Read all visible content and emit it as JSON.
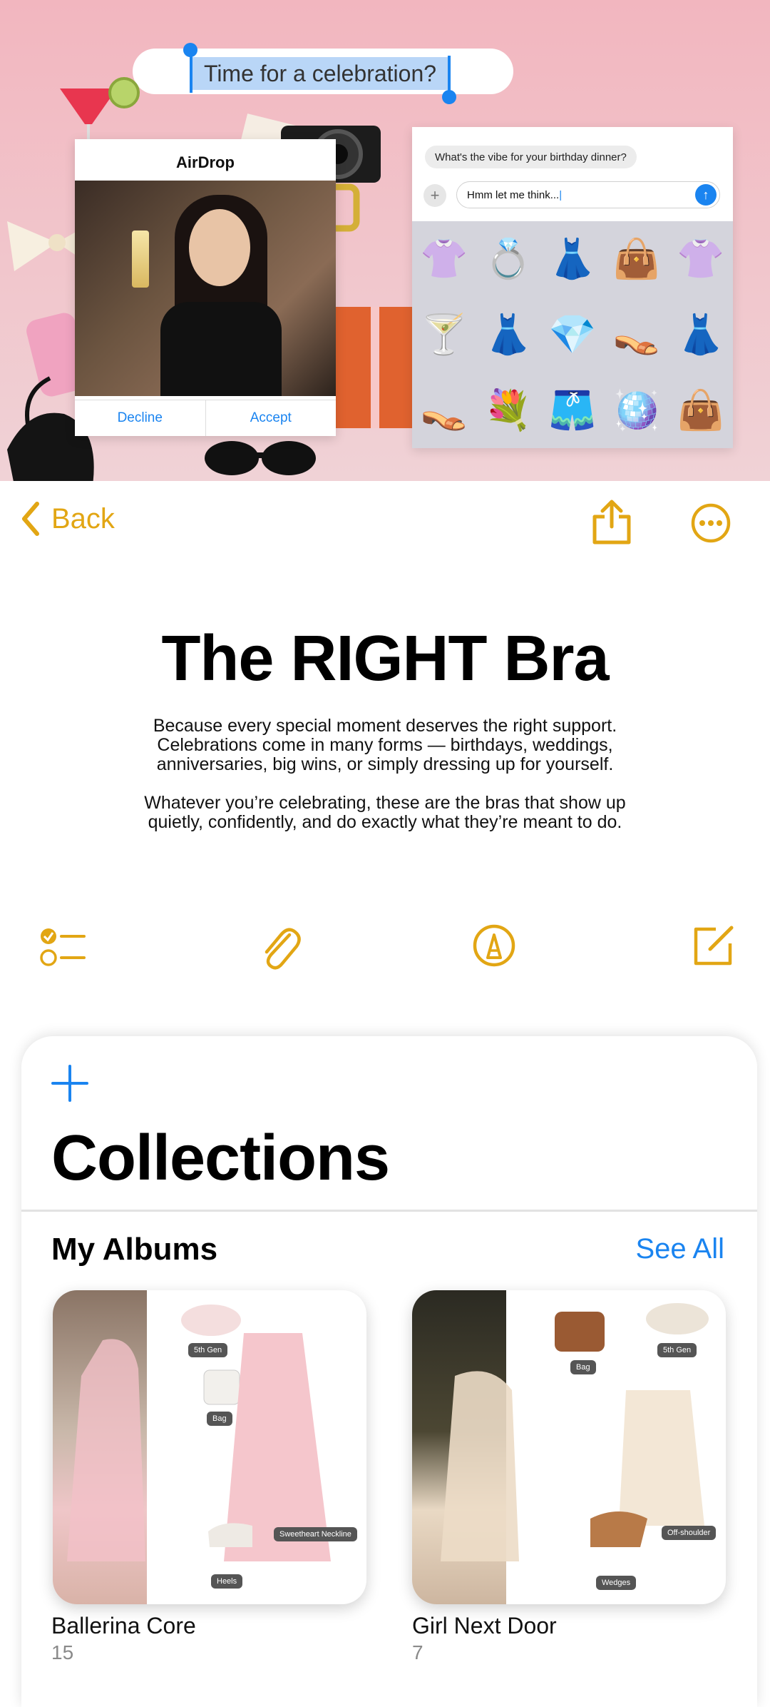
{
  "hero": {
    "title_text": "Time for a celebration?",
    "airdrop": {
      "title": "AirDrop",
      "decline": "Decline",
      "accept": "Accept"
    },
    "chat": {
      "bubble": "What's the vibe for your birthday dinner?",
      "input_value": "Hmm let me think...",
      "stickers": [
        "👚",
        "💍",
        "👗",
        "👜",
        "👚",
        "🍸",
        "👗",
        "💎",
        "👡",
        "👗",
        "👡",
        "💐",
        "🩳",
        "🪩",
        "👜"
      ]
    }
  },
  "nav": {
    "back_label": "Back"
  },
  "note": {
    "title": "The RIGHT Bra",
    "paragraph_1_lines": [
      "Because every special moment deserves the right support.",
      "Celebrations come in many forms — birthdays, weddings,",
      "anniversaries, big wins, or simply dressing up for yourself."
    ],
    "paragraph_2_lines": [
      "Whatever you’re celebrating, these are the bras that show up",
      "quietly, confidently, and do exactly what they’re meant to do."
    ]
  },
  "collections": {
    "title": "Collections",
    "albums_heading": "My Albums",
    "see_all": "See All",
    "albums": [
      {
        "name": "Ballerina Core",
        "count": "15",
        "tags": [
          "5th Gen",
          "Bag",
          "Sweetheart Neckline",
          "Heels"
        ]
      },
      {
        "name": "Girl Next Door",
        "count": "7",
        "tags": [
          "Bag",
          "5th Gen",
          "Off-shoulder",
          "Wedges"
        ]
      }
    ]
  },
  "colors": {
    "accent": "#e2a614",
    "link": "#1a84f0",
    "hero_bg": "#f2b6bf"
  }
}
